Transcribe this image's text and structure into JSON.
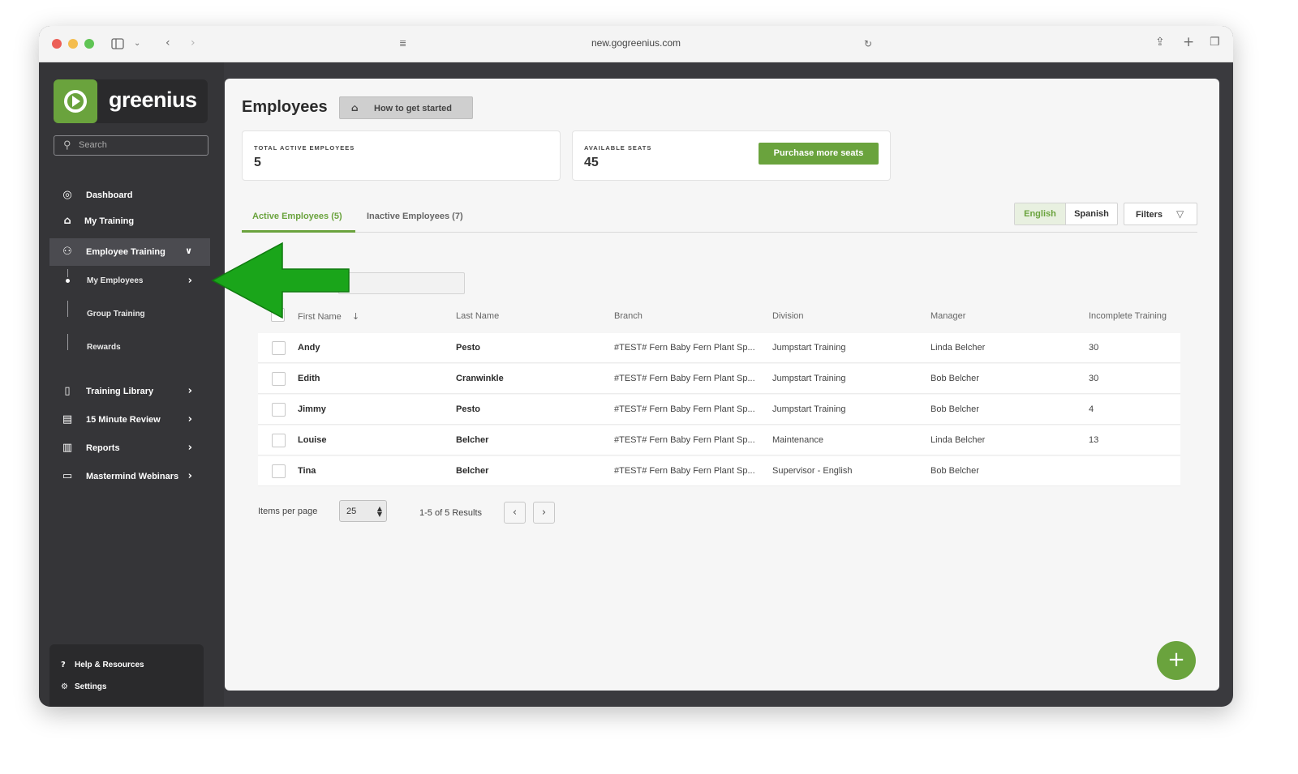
{
  "browser": {
    "url": "new.gogreenius.com"
  },
  "sidebar": {
    "logo_text": "greenius",
    "search_placeholder": "Search",
    "nav": [
      {
        "label": "Dashboard",
        "icon": "gauge-icon"
      },
      {
        "label": "My Training",
        "icon": "graduation-cap-icon"
      },
      {
        "label": "Employee Training",
        "icon": "users-icon",
        "expanded": true
      },
      {
        "label": "Training Library",
        "icon": "book-open-icon"
      },
      {
        "label": "15 Minute Review",
        "icon": "document-icon"
      },
      {
        "label": "Reports",
        "icon": "report-icon"
      },
      {
        "label": "Mastermind Webinars",
        "icon": "video-icon"
      }
    ],
    "sub_nav": [
      {
        "label": "My Employees",
        "selected": true
      },
      {
        "label": "Group Training"
      },
      {
        "label": "Rewards"
      }
    ],
    "footer": [
      {
        "label": "Help & Resources",
        "icon": "help-circle-icon"
      },
      {
        "label": "Settings",
        "icon": "gear-icon"
      }
    ]
  },
  "main": {
    "title": "Employees",
    "how_to_button": "How to get started",
    "stats": {
      "total_caption": "TOTAL ACTIVE EMPLOYEES",
      "total_value": "5",
      "seats_caption": "AVAILABLE SEATS",
      "seats_value": "45",
      "purchase_button": "Purchase more seats"
    },
    "tabs": [
      {
        "label": "Active Employees (5)",
        "active": true
      },
      {
        "label": "Inactive Employees (7)",
        "active": false
      }
    ],
    "languages": [
      {
        "label": "English",
        "selected": true
      },
      {
        "label": "Spanish",
        "selected": false
      }
    ],
    "filters_button": "Filters",
    "table": {
      "columns": [
        "First Name",
        "Last Name",
        "Branch",
        "Division",
        "Manager",
        "Incomplete Training"
      ],
      "rows": [
        [
          "Andy",
          "Pesto",
          "#TEST# Fern Baby Fern Plant Sp...",
          "Jumpstart Training",
          "Linda Belcher",
          "30"
        ],
        [
          "Edith",
          "Cranwinkle",
          "#TEST# Fern Baby Fern Plant Sp...",
          "Jumpstart Training",
          "Bob Belcher",
          "30"
        ],
        [
          "Jimmy",
          "Pesto",
          "#TEST# Fern Baby Fern Plant Sp...",
          "Jumpstart Training",
          "Bob Belcher",
          "4"
        ],
        [
          "Louise",
          "Belcher",
          "#TEST# Fern Baby Fern Plant Sp...",
          "Maintenance",
          "Linda Belcher",
          "13"
        ],
        [
          "Tina",
          "Belcher",
          "#TEST# Fern Baby Fern Plant Sp...",
          "Supervisor - English",
          "Bob Belcher",
          ""
        ]
      ]
    },
    "pagination": {
      "items_per_page_label": "Items per page",
      "items_per_page": "25",
      "results": "1-5 of 5 Results"
    },
    "fab_label": "+"
  },
  "colors": {
    "brand_green": "#6aa33d",
    "sidebar_bg": "#353538",
    "annotation_arrow": "#1aa51a"
  }
}
